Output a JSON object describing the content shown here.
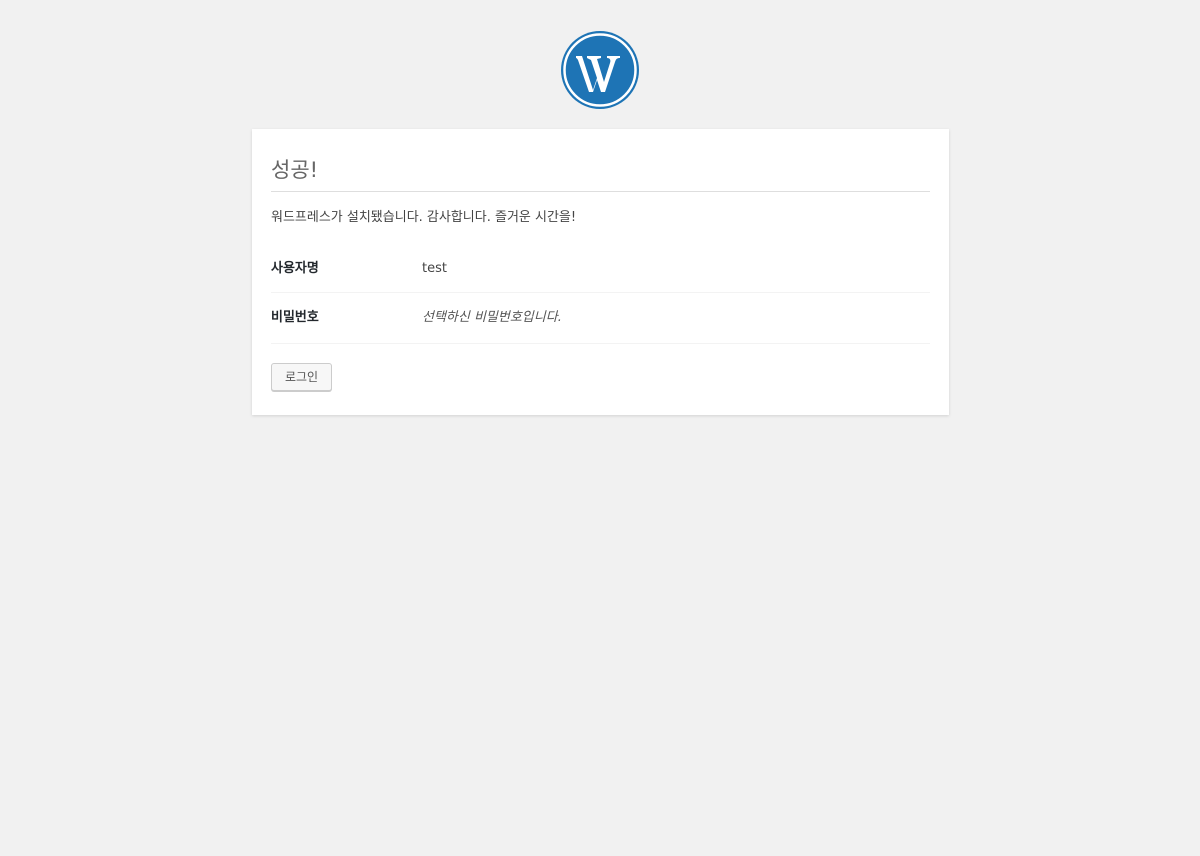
{
  "logo": {
    "icon": "wordpress-logo-icon",
    "color": "#1e74b5"
  },
  "panel": {
    "title": "성공!",
    "message": "워드프레스가 설치됐습니다. 감사합니다. 즐거운 시간을!",
    "username_label": "사용자명",
    "username_value": "test",
    "password_label": "비밀번호",
    "password_value": "선택하신 비밀번호입니다.",
    "login_button": "로그인"
  }
}
